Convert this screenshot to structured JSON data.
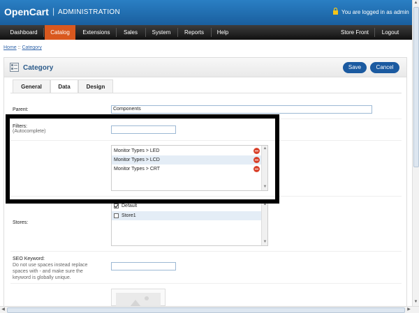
{
  "header": {
    "logo": "OpenCart",
    "separator": "|",
    "admin": "ADMINISTRATION",
    "logged_in": "You are logged in as admin"
  },
  "menu": {
    "items": [
      "Dashboard",
      "Catalog",
      "Extensions",
      "Sales",
      "System",
      "Reports",
      "Help"
    ],
    "right_items": [
      "Store Front",
      "Logout"
    ],
    "active": "Catalog"
  },
  "breadcrumb": {
    "home": "Home",
    "sep": "::",
    "current": "Category"
  },
  "box": {
    "title": "Category",
    "save": "Save",
    "cancel": "Cancel"
  },
  "tabs": [
    "General",
    "Data",
    "Design"
  ],
  "form": {
    "parent_label": "Parent:",
    "parent_value": "Components",
    "filters_label": "Filters:",
    "filters_hint": "(Autocomplete)",
    "filters_value": "",
    "filter_items": [
      "Monitor Types > LED",
      "Monitor Types > LCD",
      "Monitor Types > CRT"
    ],
    "stores_label": "Stores:",
    "stores": [
      {
        "name": "Default",
        "checked": true
      },
      {
        "name": "Store1",
        "checked": false
      }
    ],
    "seo_label": "SEO Keyword:",
    "seo_hint": "Do not use spaces instead replace spaces with - and make sure the keyword is globally unique.",
    "seo_value": ""
  },
  "colors": {
    "header_blue": "#1a5f9e",
    "menu_active": "#d9581e",
    "button_blue": "#1b5aa0",
    "remove_red": "#d9442e"
  }
}
